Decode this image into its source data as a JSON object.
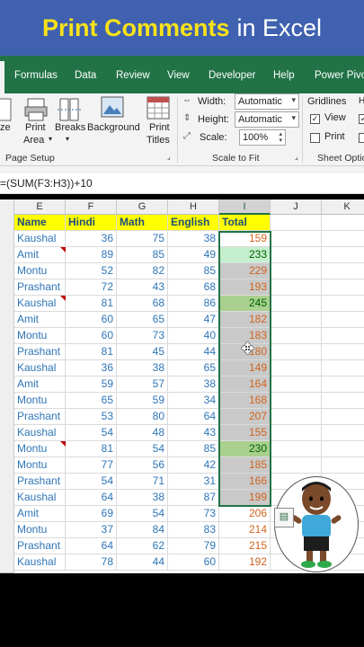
{
  "banner": {
    "title_bold": "Print Comments",
    "title_rest": "in Excel",
    "bg": "#3f61b0",
    "title_color": "#f7e21a"
  },
  "ribbon": {
    "tabs": [
      "Formulas",
      "Data",
      "Review",
      "View",
      "Developer",
      "Help",
      "Power Pivot"
    ],
    "page_setup": {
      "size_label": "ze",
      "print_area_label_1": "Print",
      "print_area_label_2": "Area",
      "breaks_label": "Breaks",
      "background_label": "Background",
      "print_titles_label_1": "Print",
      "print_titles_label_2": "Titles",
      "group_label": "Page Setup"
    },
    "scale_to_fit": {
      "width_label": "Width:",
      "width_value": "Automatic",
      "height_label": "Height:",
      "height_value": "Automatic",
      "scale_label": "Scale:",
      "scale_value": "100%",
      "group_label": "Scale to Fit"
    },
    "sheet_options": {
      "gridlines_label": "Gridlines",
      "view_label": "View",
      "view_checked": true,
      "print_label": "Print",
      "print_checked": false,
      "group_label": "Sheet Optic"
    }
  },
  "formula_bar": {
    "text": "=(SUM(F3:H3))+10"
  },
  "columns": [
    "E",
    "F",
    "G",
    "H",
    "I",
    "J",
    "K"
  ],
  "header_row": [
    "Name",
    "Hindi",
    "Math",
    "English",
    "Total"
  ],
  "rows": [
    {
      "name": "Kaushal",
      "hindi": "36",
      "math": "75",
      "english": "38",
      "total": "159",
      "comment": false,
      "fill": "none"
    },
    {
      "name": "Amit",
      "hindi": "89",
      "math": "85",
      "english": "49",
      "total": "233",
      "comment": true,
      "fill": "green-light"
    },
    {
      "name": "Montu",
      "hindi": "52",
      "math": "82",
      "english": "85",
      "total": "229",
      "comment": false,
      "fill": "grey"
    },
    {
      "name": "Prashant",
      "hindi": "72",
      "math": "43",
      "english": "68",
      "total": "193",
      "comment": false,
      "fill": "grey"
    },
    {
      "name": "Kaushal",
      "hindi": "81",
      "math": "68",
      "english": "86",
      "total": "245",
      "comment": true,
      "fill": "green-dark"
    },
    {
      "name": "Amit",
      "hindi": "60",
      "math": "65",
      "english": "47",
      "total": "182",
      "comment": false,
      "fill": "grey"
    },
    {
      "name": "Montu",
      "hindi": "60",
      "math": "73",
      "english": "40",
      "total": "183",
      "comment": false,
      "fill": "grey"
    },
    {
      "name": "Prashant",
      "hindi": "81",
      "math": "45",
      "english": "44",
      "total": "180",
      "comment": false,
      "fill": "grey"
    },
    {
      "name": "Kaushal",
      "hindi": "36",
      "math": "38",
      "english": "65",
      "total": "149",
      "comment": false,
      "fill": "grey"
    },
    {
      "name": "Amit",
      "hindi": "59",
      "math": "57",
      "english": "38",
      "total": "164",
      "comment": false,
      "fill": "grey"
    },
    {
      "name": "Montu",
      "hindi": "65",
      "math": "59",
      "english": "34",
      "total": "168",
      "comment": false,
      "fill": "grey"
    },
    {
      "name": "Prashant",
      "hindi": "53",
      "math": "80",
      "english": "64",
      "total": "207",
      "comment": false,
      "fill": "grey"
    },
    {
      "name": "Kaushal",
      "hindi": "54",
      "math": "48",
      "english": "43",
      "total": "155",
      "comment": false,
      "fill": "grey"
    },
    {
      "name": "Montu",
      "hindi": "81",
      "math": "54",
      "english": "85",
      "total": "230",
      "comment": true,
      "fill": "green-dark"
    },
    {
      "name": "Montu",
      "hindi": "77",
      "math": "56",
      "english": "42",
      "total": "185",
      "comment": false,
      "fill": "grey"
    },
    {
      "name": "Prashant",
      "hindi": "54",
      "math": "71",
      "english": "31",
      "total": "166",
      "comment": false,
      "fill": "grey"
    },
    {
      "name": "Kaushal",
      "hindi": "64",
      "math": "38",
      "english": "87",
      "total": "199",
      "comment": false,
      "fill": "grey"
    },
    {
      "name": "Amit",
      "hindi": "69",
      "math": "54",
      "english": "73",
      "total": "206",
      "comment": false,
      "fill": "none"
    },
    {
      "name": "Montu",
      "hindi": "37",
      "math": "84",
      "english": "83",
      "total": "214",
      "comment": false,
      "fill": "none"
    },
    {
      "name": "Prashant",
      "hindi": "64",
      "math": "62",
      "english": "79",
      "total": "215",
      "comment": false,
      "fill": "none"
    },
    {
      "name": "Kaushal",
      "hindi": "78",
      "math": "44",
      "english": "60",
      "total": "192",
      "comment": false,
      "fill": "none"
    }
  ],
  "fills": {
    "grey": "#c9c9c9",
    "green-light": "#c6efce",
    "green-dark": "#a9d08e",
    "header": "#ffff00",
    "excel_green": "#217346"
  }
}
